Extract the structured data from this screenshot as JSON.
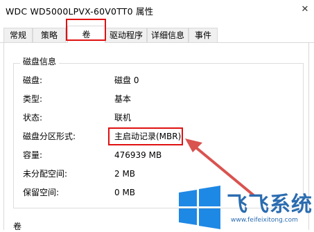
{
  "window": {
    "title": "WDC WD5000LPVX-60V0TT0 属性",
    "close_glyph": "✕"
  },
  "tabs": [
    {
      "label": "常规"
    },
    {
      "label": "策略"
    },
    {
      "label": "卷",
      "selected": true
    },
    {
      "label": "驱动程序"
    },
    {
      "label": "详细信息"
    },
    {
      "label": "事件"
    }
  ],
  "disk_info": {
    "group_title": "磁盘信息",
    "rows": [
      {
        "label": "磁盘:",
        "value": "磁盘 0"
      },
      {
        "label": "类型:",
        "value": "基本"
      },
      {
        "label": "状态:",
        "value": "联机"
      },
      {
        "label": "磁盘分区形式:",
        "value": "主启动记录(MBR)"
      },
      {
        "label": "容量:",
        "value": "476939 MB"
      },
      {
        "label": "未分配空间:",
        "value": "2 MB"
      },
      {
        "label": "保留空间:",
        "value": "0 MB"
      }
    ]
  },
  "volumes_section": {
    "title": "卷"
  },
  "watermark": {
    "brand": "飞飞系统",
    "url": "www.feifeixitong.com"
  },
  "colors": {
    "highlight_red": "#e01010",
    "arrow_red": "#d9534f",
    "brand_blue": "#2b6cb0"
  }
}
